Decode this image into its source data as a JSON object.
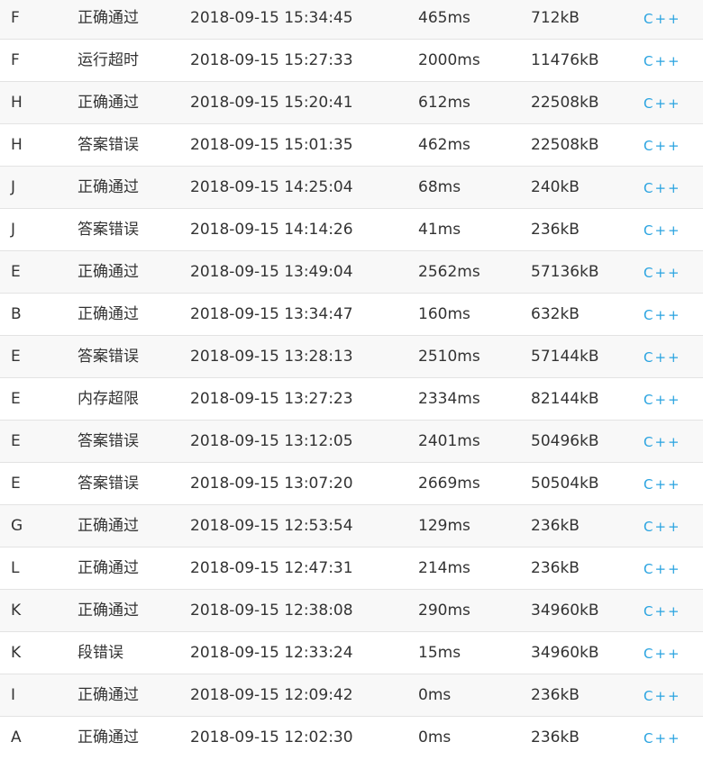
{
  "colors": {
    "language_link": "#29a3e0",
    "row_odd_bg": "#f8f8f8",
    "row_even_bg": "#ffffff",
    "text": "#333333",
    "divider": "#e3e3e3"
  },
  "submissions": [
    {
      "problem": "F",
      "status": "正确通过",
      "submit_time": "2018-09-15 15:34:45",
      "run_time": "465ms",
      "memory": "712kB",
      "language": "C++"
    },
    {
      "problem": "F",
      "status": "运行超时",
      "submit_time": "2018-09-15 15:27:33",
      "run_time": "2000ms",
      "memory": "11476kB",
      "language": "C++"
    },
    {
      "problem": "H",
      "status": "正确通过",
      "submit_time": "2018-09-15 15:20:41",
      "run_time": "612ms",
      "memory": "22508kB",
      "language": "C++"
    },
    {
      "problem": "H",
      "status": "答案错误",
      "submit_time": "2018-09-15 15:01:35",
      "run_time": "462ms",
      "memory": "22508kB",
      "language": "C++"
    },
    {
      "problem": "J",
      "status": "正确通过",
      "submit_time": "2018-09-15 14:25:04",
      "run_time": "68ms",
      "memory": "240kB",
      "language": "C++"
    },
    {
      "problem": "J",
      "status": "答案错误",
      "submit_time": "2018-09-15 14:14:26",
      "run_time": "41ms",
      "memory": "236kB",
      "language": "C++"
    },
    {
      "problem": "E",
      "status": "正确通过",
      "submit_time": "2018-09-15 13:49:04",
      "run_time": "2562ms",
      "memory": "57136kB",
      "language": "C++"
    },
    {
      "problem": "B",
      "status": "正确通过",
      "submit_time": "2018-09-15 13:34:47",
      "run_time": "160ms",
      "memory": "632kB",
      "language": "C++"
    },
    {
      "problem": "E",
      "status": "答案错误",
      "submit_time": "2018-09-15 13:28:13",
      "run_time": "2510ms",
      "memory": "57144kB",
      "language": "C++"
    },
    {
      "problem": "E",
      "status": "内存超限",
      "submit_time": "2018-09-15 13:27:23",
      "run_time": "2334ms",
      "memory": "82144kB",
      "language": "C++"
    },
    {
      "problem": "E",
      "status": "答案错误",
      "submit_time": "2018-09-15 13:12:05",
      "run_time": "2401ms",
      "memory": "50496kB",
      "language": "C++"
    },
    {
      "problem": "E",
      "status": "答案错误",
      "submit_time": "2018-09-15 13:07:20",
      "run_time": "2669ms",
      "memory": "50504kB",
      "language": "C++"
    },
    {
      "problem": "G",
      "status": "正确通过",
      "submit_time": "2018-09-15 12:53:54",
      "run_time": "129ms",
      "memory": "236kB",
      "language": "C++"
    },
    {
      "problem": "L",
      "status": "正确通过",
      "submit_time": "2018-09-15 12:47:31",
      "run_time": "214ms",
      "memory": "236kB",
      "language": "C++"
    },
    {
      "problem": "K",
      "status": "正确通过",
      "submit_time": "2018-09-15 12:38:08",
      "run_time": "290ms",
      "memory": "34960kB",
      "language": "C++"
    },
    {
      "problem": "K",
      "status": "段错误",
      "submit_time": "2018-09-15 12:33:24",
      "run_time": "15ms",
      "memory": "34960kB",
      "language": "C++"
    },
    {
      "problem": "I",
      "status": "正确通过",
      "submit_time": "2018-09-15 12:09:42",
      "run_time": "0ms",
      "memory": "236kB",
      "language": "C++"
    },
    {
      "problem": "A",
      "status": "正确通过",
      "submit_time": "2018-09-15 12:02:30",
      "run_time": "0ms",
      "memory": "236kB",
      "language": "C++"
    }
  ]
}
